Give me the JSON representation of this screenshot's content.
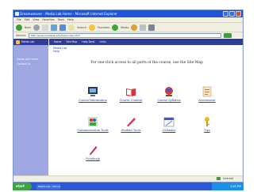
{
  "window": {
    "title": "Dreamweaver - Media Lab Home - Microsoft Internet Explorer"
  },
  "menubar": [
    "File",
    "Edit",
    "View",
    "Favorites",
    "Tools",
    "Help"
  ],
  "toolbar": {
    "back_label": "Back",
    "search_label": "Search",
    "favorites_label": "Favorites",
    "media_label": "Media"
  },
  "address": {
    "label": "Address",
    "value": "http://www.medialab.edu/help/index.html"
  },
  "sidebar": {
    "title": "Media Lab",
    "links": [
      "Media Lab Home",
      "Contact Us"
    ]
  },
  "topnav": [
    "Home",
    "Site Map",
    "Help Desk",
    "Links"
  ],
  "main": {
    "breadcrumb": [
      "Media Lab",
      "Help"
    ],
    "intro": "For one-click access to all parts of the course, use the Site Map"
  },
  "items": [
    {
      "label": "Course Information",
      "icon": "computer-icon"
    },
    {
      "label": "Course Content",
      "icon": "book-icon"
    },
    {
      "label": "Course Syllabus",
      "icon": "globe-icon"
    },
    {
      "label": "Assessment",
      "icon": "document-icon"
    },
    {
      "label": "Communication Tools",
      "icon": "people-icon"
    },
    {
      "label": "Student Tools",
      "icon": "pencil-icon"
    },
    {
      "label": "Calendar",
      "icon": "calendar-icon"
    },
    {
      "label": "Tips",
      "icon": "key-icon"
    },
    {
      "label": "Notebook",
      "icon": "notebook-pen-icon"
    }
  ],
  "status": {
    "text": "Internet"
  },
  "taskbar": {
    "start_label": "start",
    "task_label": "Media Lab - Microsoft",
    "clock": "3:45 PM"
  },
  "colors": {
    "sidebar": "#9ea7e1",
    "nav": "#2e3c98",
    "link": "#1d3fb0"
  }
}
